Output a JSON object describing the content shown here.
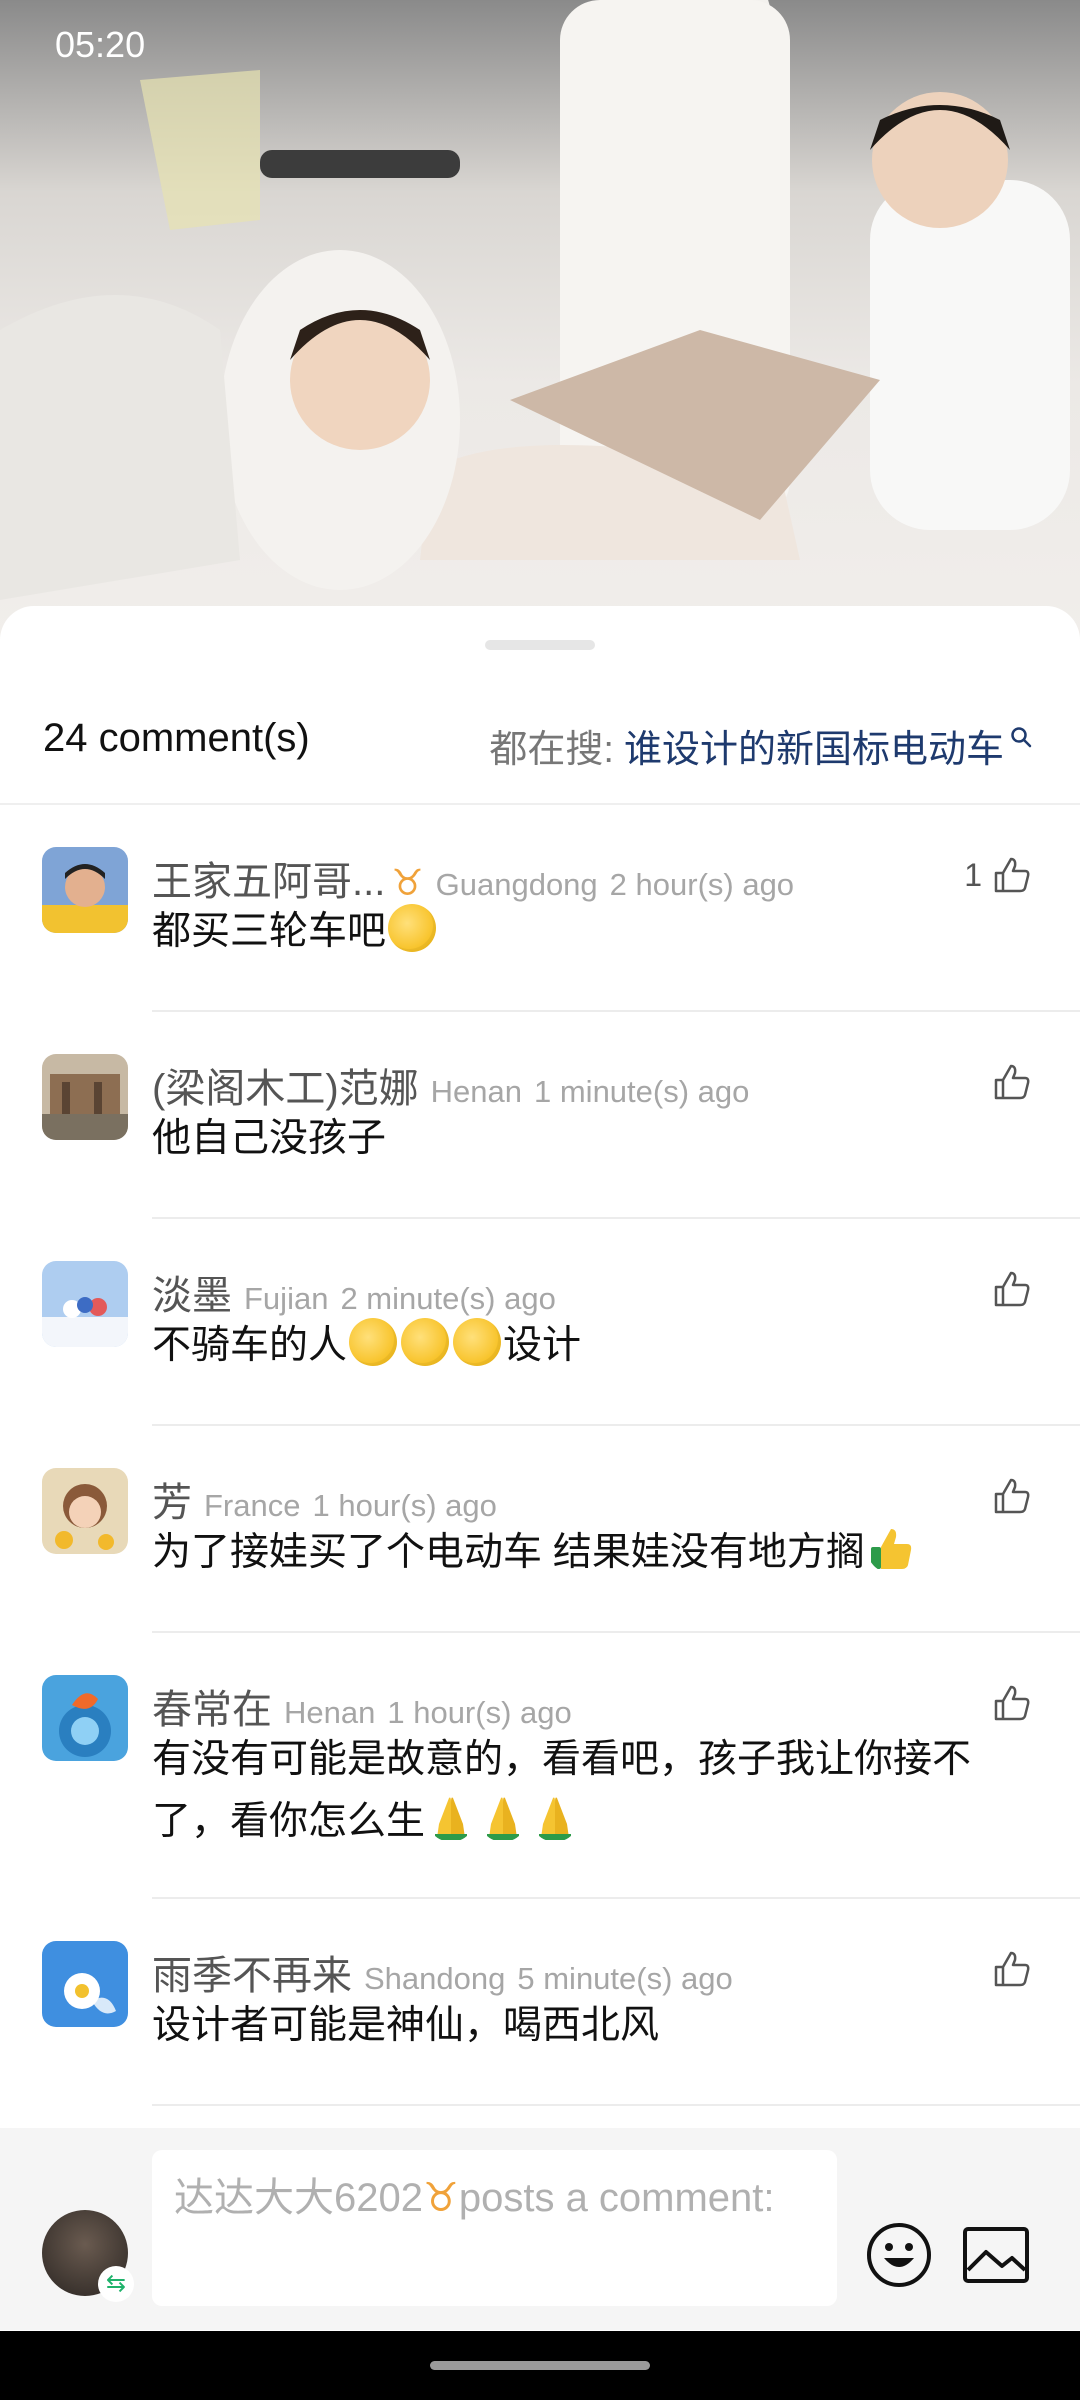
{
  "status_bar": {
    "time": "05:20"
  },
  "sheet": {
    "comment_count_label": "24 comment(s)",
    "hot_search_label": "都在搜:",
    "hot_search_term": "谁设计的新国标电动车"
  },
  "comments": [
    {
      "name": "王家五阿哥...",
      "badge": "♉",
      "location": "Guangdong",
      "time": "2 hour(s) ago",
      "text": "都买三轮车吧",
      "likes": "1"
    },
    {
      "name": "(梁阁木工)范娜",
      "location": "Henan",
      "time": "1 minute(s) ago",
      "text": "他自己没孩子",
      "likes": ""
    },
    {
      "name": "淡墨",
      "location": "Fujian",
      "time": "2 minute(s) ago",
      "text": "不骑车的人",
      "text_suffix": "设计",
      "likes": ""
    },
    {
      "name": "芳",
      "location": "France",
      "time": "1 hour(s) ago",
      "text": "为了接娃买了个电动车 结果娃没有地方搁",
      "likes": ""
    },
    {
      "name": "春常在",
      "location": "Henan",
      "time": "1 hour(s) ago",
      "text": "有没有可能是故意的，看看吧，孩子我让你接不了，看你怎么生",
      "likes": ""
    },
    {
      "name": "雨季不再来",
      "location": "Shandong",
      "time": "5 minute(s) ago",
      "text": "设计者可能是神仙，喝西北风",
      "likes": ""
    }
  ],
  "input": {
    "placeholder_user": "达达大大6202",
    "placeholder_badge": "♉",
    "placeholder_text": "posts a comment:"
  },
  "icons": {
    "like": "thumbs-up-icon",
    "search": "search-icon",
    "emoji": "smiley-icon",
    "image": "image-icon"
  },
  "colors": {
    "accent_link": "#1e3a6e",
    "badge": "#f0a23a"
  }
}
